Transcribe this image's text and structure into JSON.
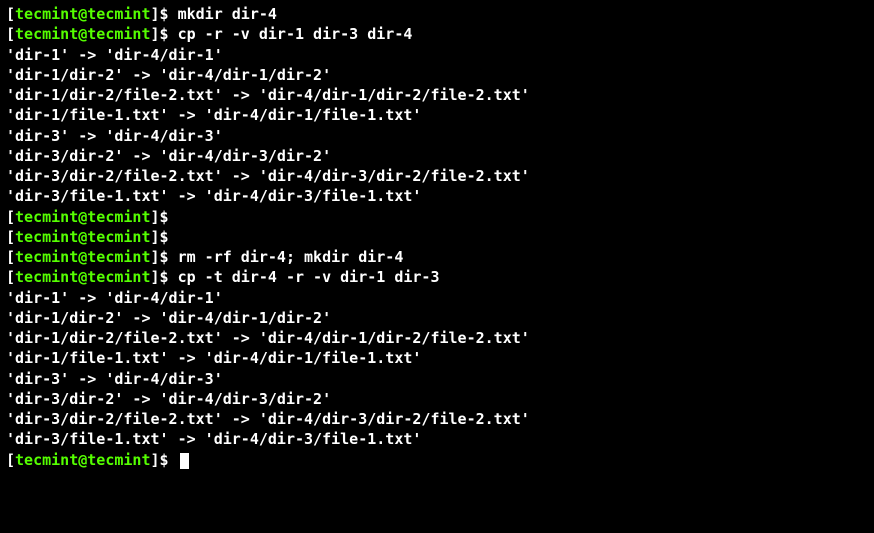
{
  "prompt": {
    "open_bracket": "[",
    "user_host": "tecmint@tecmint",
    "close_bracket": "]",
    "dollar": "$"
  },
  "lines": [
    {
      "type": "cmd",
      "text": "mkdir dir-4"
    },
    {
      "type": "cmd",
      "text": "cp -r -v dir-1 dir-3 dir-4"
    },
    {
      "type": "out",
      "text": "'dir-1' -> 'dir-4/dir-1'"
    },
    {
      "type": "out",
      "text": "'dir-1/dir-2' -> 'dir-4/dir-1/dir-2'"
    },
    {
      "type": "out",
      "text": "'dir-1/dir-2/file-2.txt' -> 'dir-4/dir-1/dir-2/file-2.txt'"
    },
    {
      "type": "out",
      "text": "'dir-1/file-1.txt' -> 'dir-4/dir-1/file-1.txt'"
    },
    {
      "type": "out",
      "text": "'dir-3' -> 'dir-4/dir-3'"
    },
    {
      "type": "out",
      "text": "'dir-3/dir-2' -> 'dir-4/dir-3/dir-2'"
    },
    {
      "type": "out",
      "text": "'dir-3/dir-2/file-2.txt' -> 'dir-4/dir-3/dir-2/file-2.txt'"
    },
    {
      "type": "out",
      "text": "'dir-3/file-1.txt' -> 'dir-4/dir-3/file-1.txt'"
    },
    {
      "type": "cmd",
      "text": ""
    },
    {
      "type": "cmd",
      "text": ""
    },
    {
      "type": "cmd",
      "text": "rm -rf dir-4; mkdir dir-4"
    },
    {
      "type": "cmd",
      "text": "cp -t dir-4 -r -v dir-1 dir-3"
    },
    {
      "type": "out",
      "text": "'dir-1' -> 'dir-4/dir-1'"
    },
    {
      "type": "out",
      "text": "'dir-1/dir-2' -> 'dir-4/dir-1/dir-2'"
    },
    {
      "type": "out",
      "text": "'dir-1/dir-2/file-2.txt' -> 'dir-4/dir-1/dir-2/file-2.txt'"
    },
    {
      "type": "out",
      "text": "'dir-1/file-1.txt' -> 'dir-4/dir-1/file-1.txt'"
    },
    {
      "type": "out",
      "text": "'dir-3' -> 'dir-4/dir-3'"
    },
    {
      "type": "out",
      "text": "'dir-3/dir-2' -> 'dir-4/dir-3/dir-2'"
    },
    {
      "type": "out",
      "text": "'dir-3/dir-2/file-2.txt' -> 'dir-4/dir-3/dir-2/file-2.txt'"
    },
    {
      "type": "out",
      "text": "'dir-3/file-1.txt' -> 'dir-4/dir-3/file-1.txt'"
    },
    {
      "type": "cmd",
      "text": "",
      "cursor": true
    }
  ]
}
